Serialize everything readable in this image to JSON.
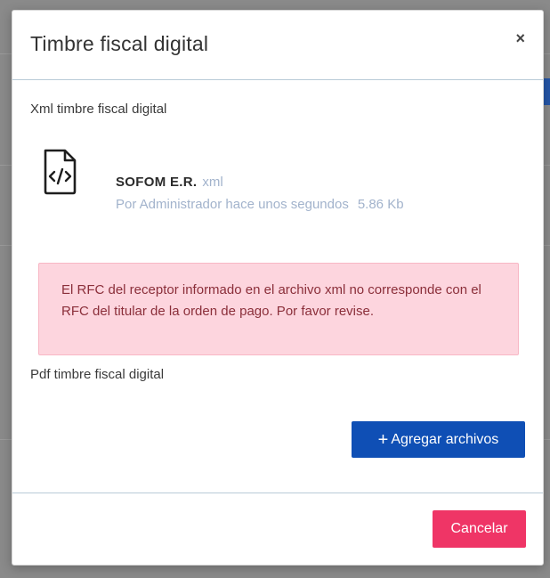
{
  "modal": {
    "title": "Timbre fiscal digital",
    "close_symbol": "×"
  },
  "xml_section": {
    "label": "Xml timbre fiscal digital",
    "file": {
      "icon": "code-file-icon",
      "name": "SOFOM E.R.",
      "extension": "xml",
      "meta": "Por Administrador hace unos segundos",
      "size": "5.86 Kb"
    }
  },
  "alert": {
    "message": "El RFC del receptor informado en el archivo xml no corresponde con el RFC del titular de la orden de pago. Por favor revise."
  },
  "pdf_section": {
    "label": "Pdf timbre fiscal digital",
    "add_button_label": "Agregar archivos",
    "add_button_symbol": "+"
  },
  "footer": {
    "cancel_label": "Cancelar"
  },
  "colors": {
    "primary": "#0f4fb5",
    "danger": "#ef3566",
    "alert_bg": "#fdd5de",
    "alert_text": "#8b2f3a",
    "muted": "#a2b3cc"
  }
}
